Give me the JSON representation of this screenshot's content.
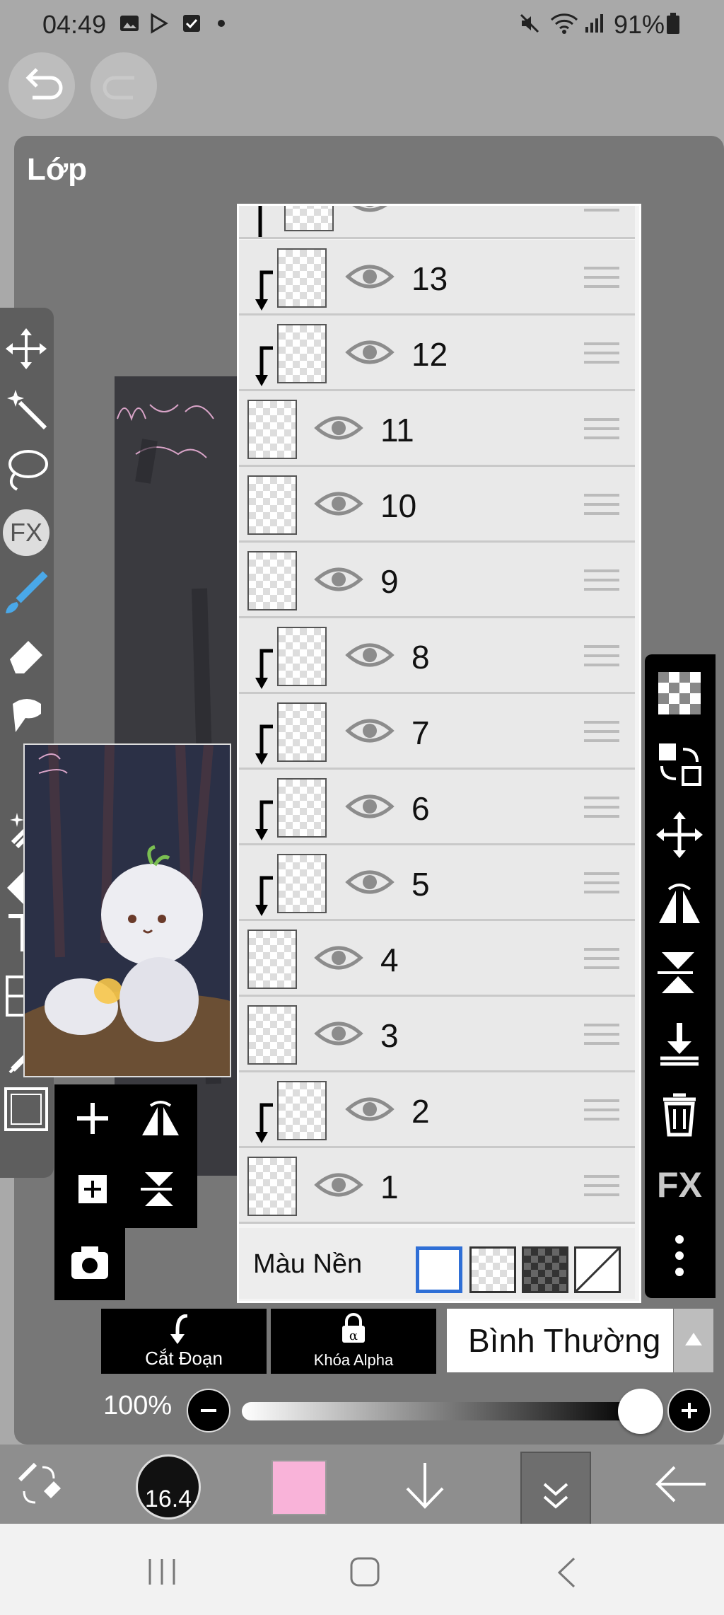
{
  "status_bar": {
    "time": "04:49",
    "battery": "91%"
  },
  "panel": {
    "title": "Lớp"
  },
  "layers": [
    {
      "label": "13",
      "clipped": true
    },
    {
      "label": "12",
      "clipped": true
    },
    {
      "label": "11",
      "clipped": false
    },
    {
      "label": "10",
      "clipped": false
    },
    {
      "label": "9",
      "clipped": false
    },
    {
      "label": "8",
      "clipped": true
    },
    {
      "label": "7",
      "clipped": true
    },
    {
      "label": "6",
      "clipped": true
    },
    {
      "label": "5",
      "clipped": true
    },
    {
      "label": "4",
      "clipped": false
    },
    {
      "label": "3",
      "clipped": false
    },
    {
      "label": "2",
      "clipped": true
    },
    {
      "label": "1",
      "clipped": false
    }
  ],
  "background_row": {
    "label": "Màu Nền"
  },
  "controls": {
    "clipping_label": "Cắt Đoạn",
    "alpha_lock_label": "Khóa Alpha",
    "blend_mode": "Bình Thường",
    "opacity": "100%"
  },
  "toolbar": {
    "brush_size": "16.4",
    "current_color": "#f9b3d9"
  },
  "action_strip": {
    "fx_label": "FX"
  },
  "left_tools": {
    "fx_label": "FX"
  }
}
